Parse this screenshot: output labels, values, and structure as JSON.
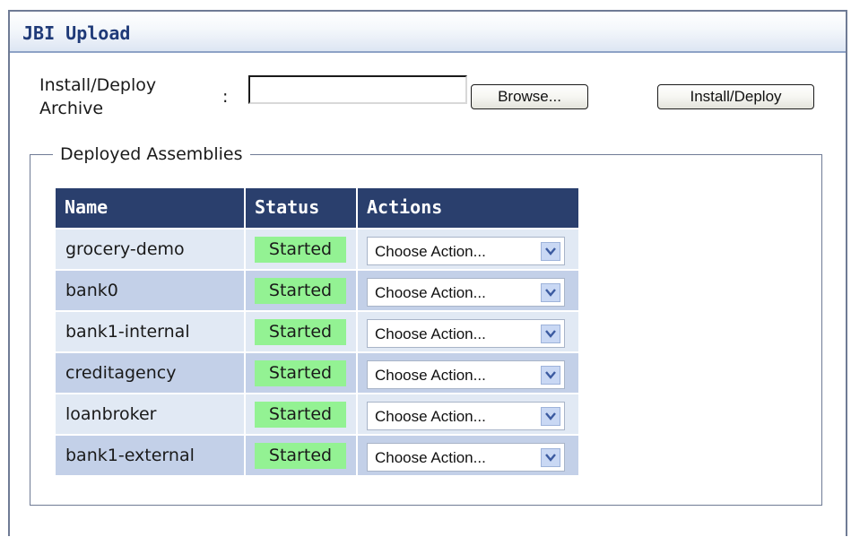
{
  "panel": {
    "title": "JBI Upload"
  },
  "upload": {
    "label_line1": "Install/Deploy",
    "label_line2": "Archive",
    "colon": ":",
    "file_value": "",
    "browse_label": "Browse...",
    "deploy_label": "Install/Deploy"
  },
  "assemblies": {
    "legend": "Deployed Assemblies",
    "columns": [
      "Name",
      "Status",
      "Actions"
    ],
    "rows": [
      {
        "name": "grocery-demo",
        "status": "Started",
        "action": "Choose Action..."
      },
      {
        "name": "bank0",
        "status": "Started",
        "action": "Choose Action..."
      },
      {
        "name": "bank1-internal",
        "status": "Started",
        "action": "Choose Action..."
      },
      {
        "name": "creditagency",
        "status": "Started",
        "action": "Choose Action..."
      },
      {
        "name": "loanbroker",
        "status": "Started",
        "action": "Choose Action..."
      },
      {
        "name": "bank1-external",
        "status": "Started",
        "action": "Choose Action..."
      }
    ]
  },
  "icons": {
    "dropdown": "chevron-down-icon"
  },
  "colors": {
    "header_bg": "#2a3f6d",
    "row_light": "#e1e9f4",
    "row_dark": "#c3d0e8",
    "status_started": "#93f293",
    "title_text": "#1f3a78"
  }
}
